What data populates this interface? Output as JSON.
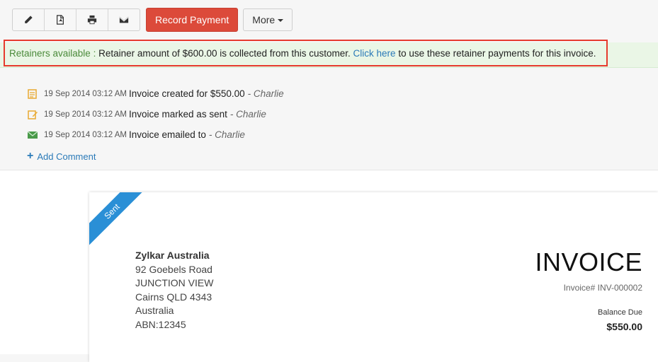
{
  "toolbar": {
    "icons": [
      "pencil-icon",
      "pdf-icon",
      "print-icon",
      "mail-icon"
    ],
    "record_payment_label": "Record Payment",
    "more_label": "More"
  },
  "retainer": {
    "label": "Retainers available :",
    "text": "Retainer amount of $600.00 is collected from this customer.",
    "link": "Click here",
    "suffix": "to use these retainer payments for this invoice."
  },
  "activity": [
    {
      "icon": "note-icon",
      "time": "19 Sep 2014 03:12 AM",
      "text": "Invoice created for $550.00",
      "by": "- Charlie"
    },
    {
      "icon": "edit-note-icon",
      "time": "19 Sep 2014 03:12 AM",
      "text": "Invoice marked as sent",
      "by": "- Charlie"
    },
    {
      "icon": "envelope-icon",
      "time": "19 Sep 2014 03:12 AM",
      "text": "Invoice emailed to",
      "by": "- Charlie"
    }
  ],
  "add_comment_label": "Add Comment",
  "invoice": {
    "status_ribbon": "Sent",
    "company": {
      "name": "Zylkar Australia",
      "address1": "92 Goebels Road",
      "address2": "JUNCTION VIEW",
      "address3": "Cairns QLD 4343",
      "country": "Australia",
      "abn": "ABN:12345"
    },
    "title": "INVOICE",
    "number": "Invoice# INV-000002",
    "balance_label": "Balance Due",
    "balance_value": "$550.00"
  },
  "colors": {
    "primary": "#dc4a3a",
    "link": "#2a7ab8",
    "ribbon": "#2a8fd6",
    "highlight_border": "#e63b2e",
    "retainer_bg": "#eaf6e6"
  }
}
